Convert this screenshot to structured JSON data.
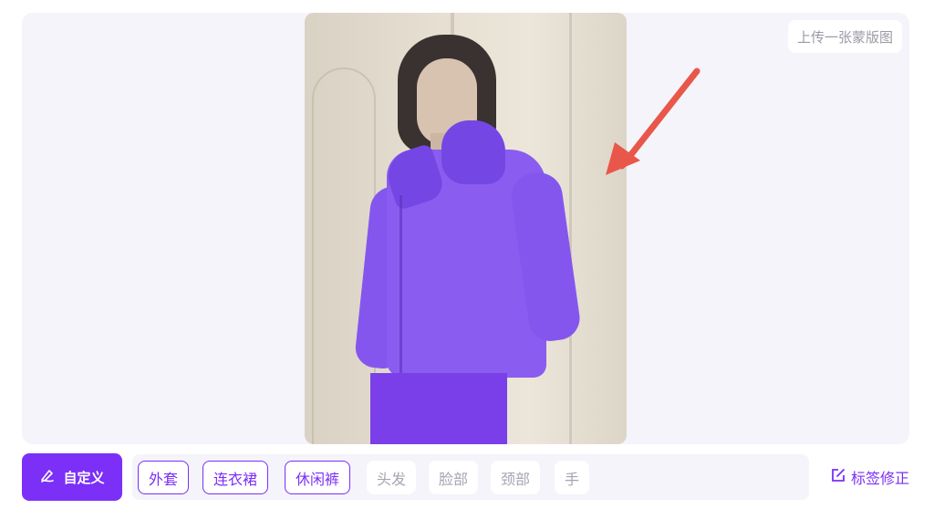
{
  "canvas": {
    "upload_mask_label": "上传一张蒙版图"
  },
  "toolbar": {
    "custom_label": "自定义",
    "tags": [
      {
        "label": "外套",
        "active": true
      },
      {
        "label": "连衣裙",
        "active": true
      },
      {
        "label": "休闲裤",
        "active": true
      },
      {
        "label": "头发",
        "active": false
      },
      {
        "label": "脸部",
        "active": false
      },
      {
        "label": "颈部",
        "active": false
      },
      {
        "label": "手",
        "active": false
      }
    ],
    "fix_label": "标签修正"
  },
  "colors": {
    "accent": "#7b2ff7",
    "mask": "#8a5cf0",
    "arrow": "#e8574a"
  },
  "icons": {
    "custom": "pen-icon",
    "fix": "edit-square-icon"
  }
}
